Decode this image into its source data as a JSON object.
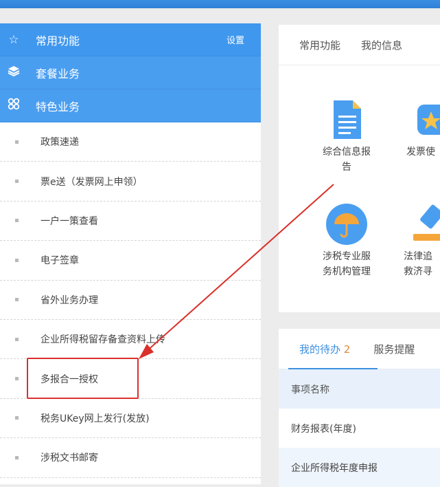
{
  "sidebar": {
    "sections": [
      {
        "label": "常用功能",
        "icon": "star-icon",
        "setting": "设置"
      },
      {
        "label": "套餐业务",
        "icon": "layers-icon"
      },
      {
        "label": "特色业务",
        "icon": "clover-icon"
      }
    ],
    "items": [
      "政策速递",
      "票e送（发票网上申领）",
      "一户一策查看",
      "电子签章",
      "省外业务办理",
      "企业所得税留存备查资料上传",
      "多报合一授权",
      "税务UKey网上发行(发放)",
      "涉税文书邮寄"
    ]
  },
  "top_panel": {
    "tabs": [
      "常用功能",
      "我的信息"
    ],
    "tiles": [
      {
        "line1": "综合信息报",
        "line2": "告",
        "icon": "document-icon"
      },
      {
        "line1": "发票使",
        "line2": "",
        "icon": "star-badge-icon"
      },
      {
        "line1": "涉税专业服",
        "line2": "务机构管理",
        "icon": "umbrella-icon"
      },
      {
        "line1": "法律追",
        "line2": "救济寻",
        "icon": "gavel-icon"
      }
    ]
  },
  "bottom_panel": {
    "tab_active": "我的待办",
    "tab_count": "2",
    "tab_second": "服务提醒",
    "header": "事项名称",
    "rows": [
      "财务报表(年度)",
      "企业所得税年度申报"
    ]
  },
  "colors": {
    "accent": "#4a9ef0",
    "highlight": "#d9302b"
  }
}
